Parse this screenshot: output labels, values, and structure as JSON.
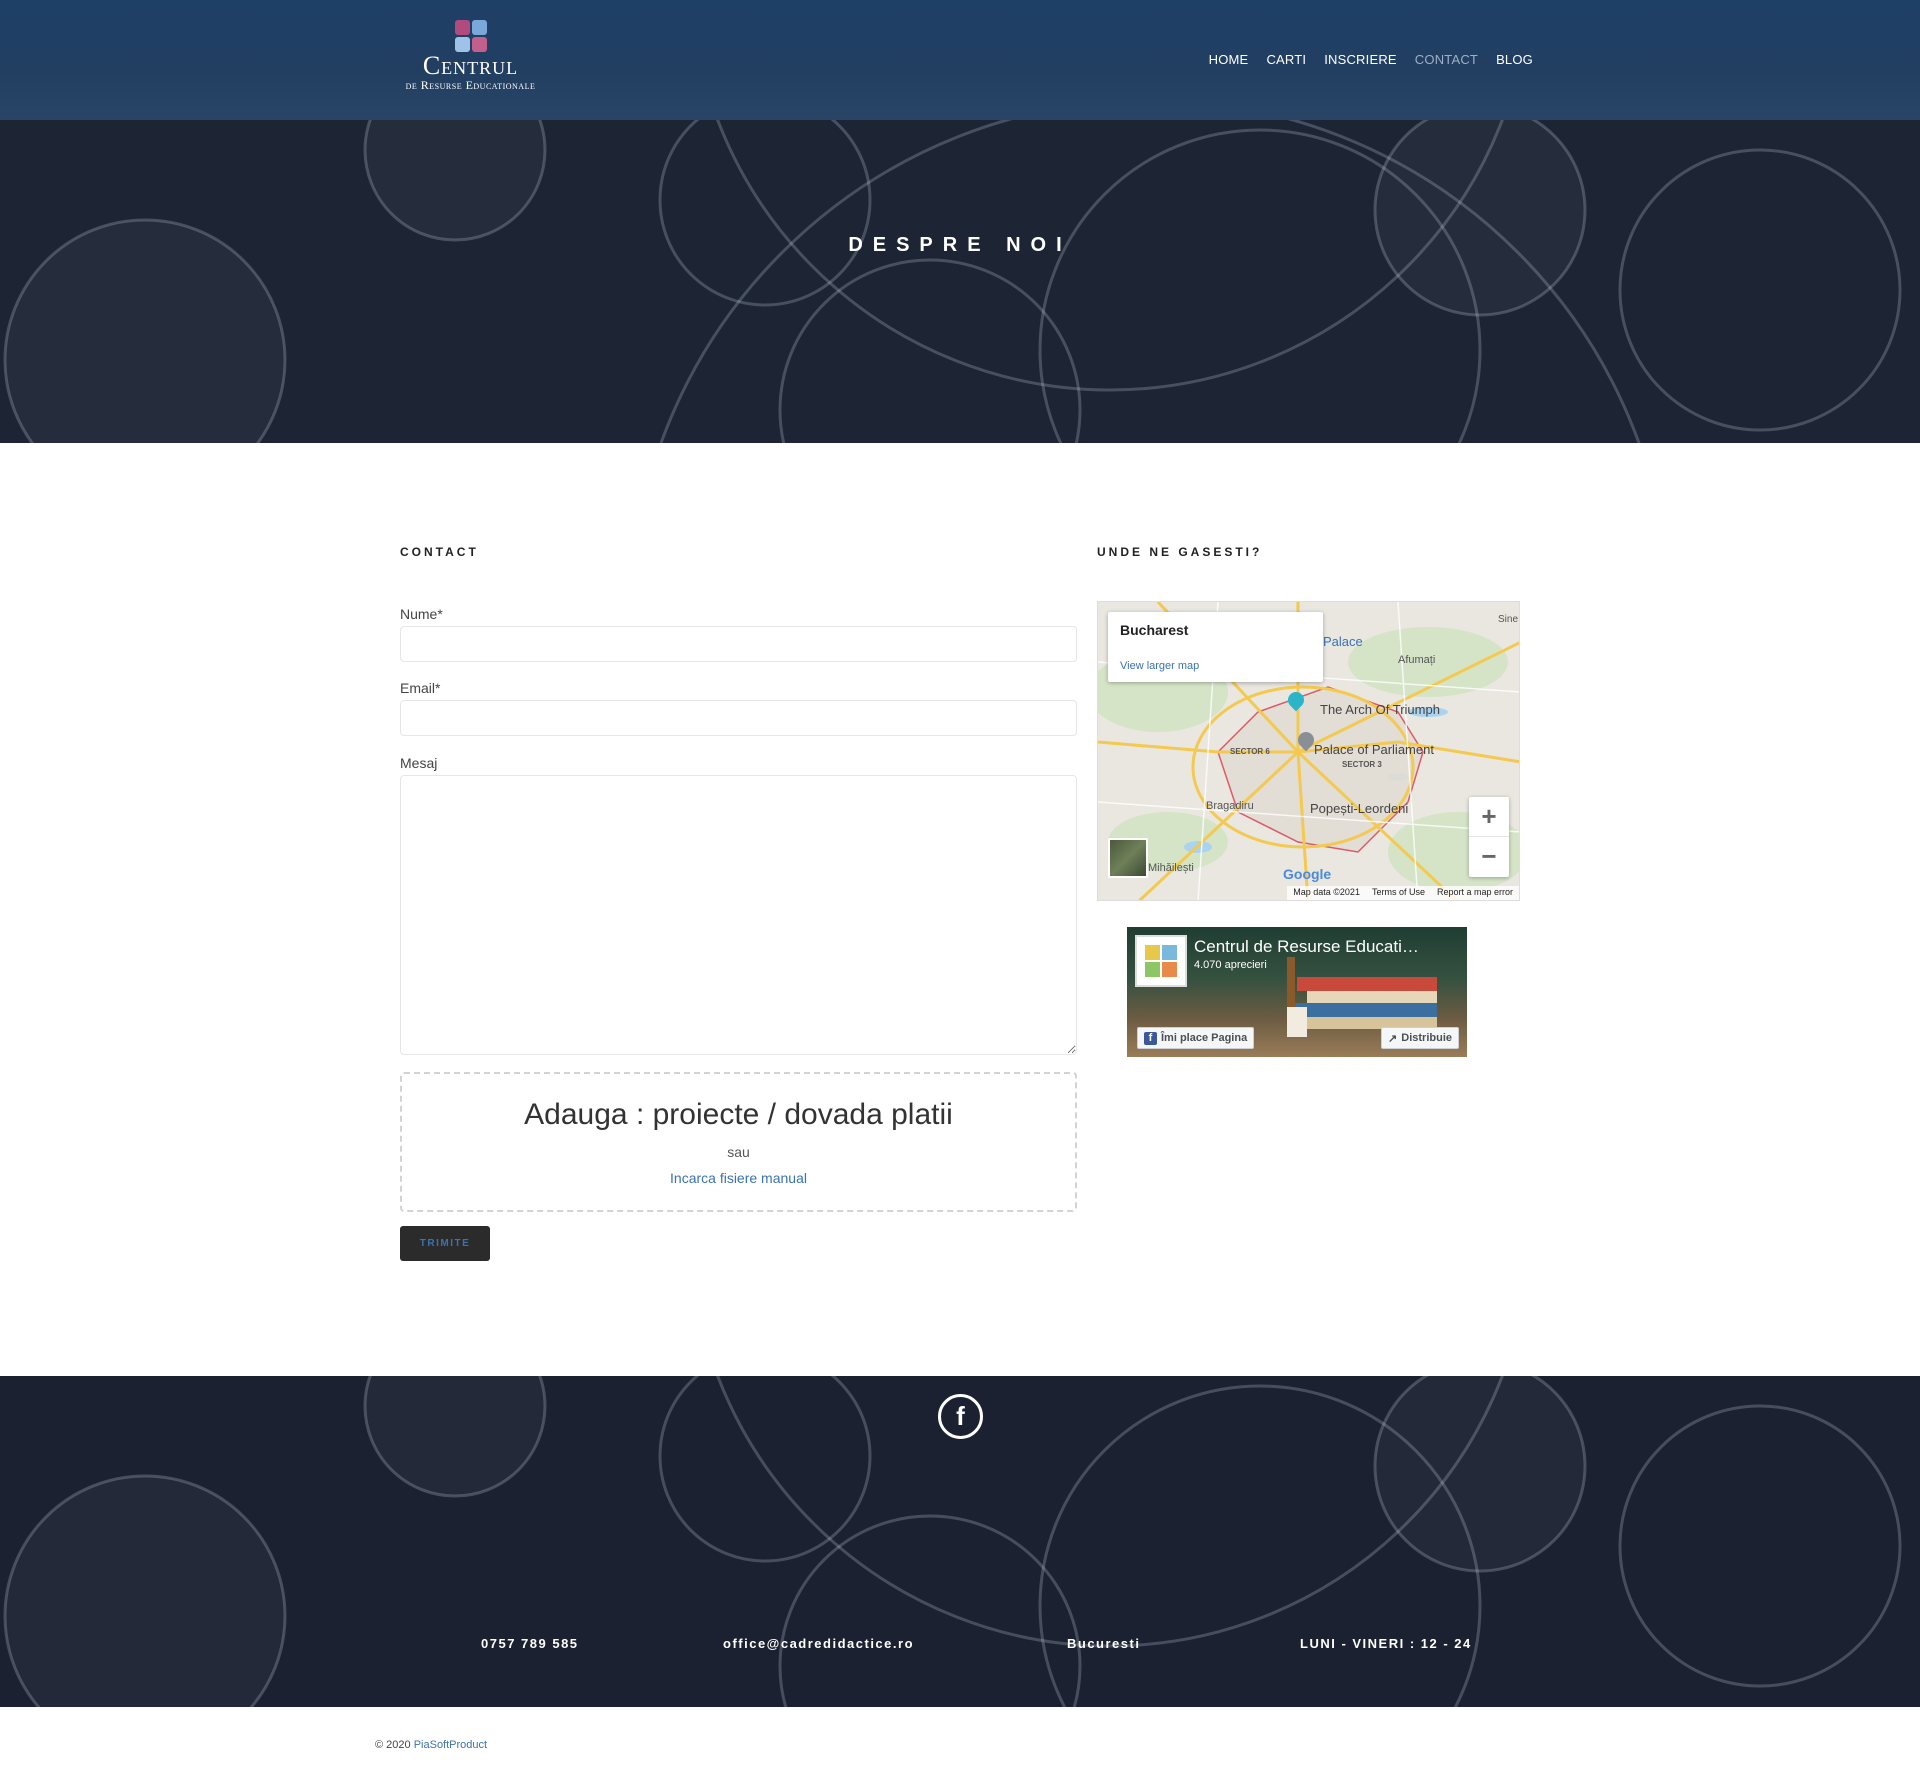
{
  "brand": {
    "title": "Centrul",
    "subtitle": "de Resurse Educationale"
  },
  "nav": {
    "items": [
      {
        "label": "HOME"
      },
      {
        "label": "CARTI"
      },
      {
        "label": "INSCRIERE"
      },
      {
        "label": "CONTACT",
        "active": true
      },
      {
        "label": "BLOG"
      }
    ]
  },
  "hero": {
    "title": "DESPRE NOI"
  },
  "contact": {
    "heading": "CONTACT",
    "name_label": "Nume*",
    "email_label": "Email*",
    "message_label": "Mesaj",
    "dropzone_title": "Adauga : proiecte / dovada platii",
    "dropzone_or": "sau",
    "dropzone_link": "Incarca fisiere manual",
    "submit_label": "TRIMITE"
  },
  "location": {
    "heading": "UNDE NE GASESTI?",
    "map": {
      "place": "Bucharest",
      "larger_map": "View larger map",
      "labels": {
        "arch": "The Arch Of Triumph",
        "parliament": "Palace of Parliament",
        "palace": "Palace",
        "afumati": "Afumați",
        "sector6": "SECTOR 6",
        "sector3": "SECTOR 3",
        "bragadiru": "Bragadiru",
        "popesti": "Popești-Leordeni",
        "mihailesti": "Mihăilești",
        "sine": "Sine"
      },
      "zoom_in": "+",
      "zoom_out": "−",
      "google": "Google",
      "map_data": "Map data ©2021",
      "terms": "Terms of Use",
      "report": "Report a map error"
    },
    "facebook": {
      "page_name": "Centrul de Resurse Educati…",
      "likes": "4.070 aprecieri",
      "like_btn": "Îmi place Pagina",
      "share_btn": "Distribuie"
    }
  },
  "footer": {
    "phone": "0757 789 585",
    "email": "office@cadredidactice.ro",
    "city": "Bucuresti",
    "hours": "LUNI - VINERI : 12 - 24",
    "copyright_prefix": "© 2020",
    "copyright_link": "PiaSoftProduct"
  },
  "colors": {
    "header": "#223f62",
    "hero": "#1d2433",
    "link": "#3a72b5",
    "button": "#2b2b2b"
  }
}
